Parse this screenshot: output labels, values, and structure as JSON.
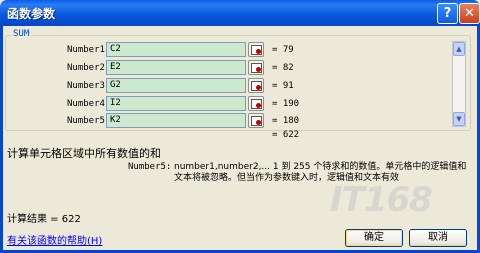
{
  "window": {
    "title": "函数参数",
    "help_icon": "question-mark-icon",
    "close_icon": "close-icon"
  },
  "function": {
    "name": "SUM",
    "rows": [
      {
        "label": "Number1",
        "value": "C2",
        "result": "= 79"
      },
      {
        "label": "Number2",
        "value": "E2",
        "result": "= 82"
      },
      {
        "label": "Number3",
        "value": "G2",
        "result": "= 91"
      },
      {
        "label": "Number4",
        "value": "I2",
        "result": "= 190"
      },
      {
        "label": "Number5",
        "value": "K2",
        "result": "= 180"
      }
    ],
    "total": "= 622"
  },
  "description": "计算单元格区域中所有数值的和",
  "param_help": {
    "name": "Number5:",
    "text": "number1,number2,... 1 到 255 个待求和的数值。单元格中的逻辑值和文本将被忽略。但当作为参数键入时，逻辑值和文本有效"
  },
  "result_text": "计算结果 = 622",
  "help_link": "有关该函数的帮助(H)",
  "buttons": {
    "ok": "确定",
    "cancel": "取消"
  },
  "watermark": "IT168"
}
